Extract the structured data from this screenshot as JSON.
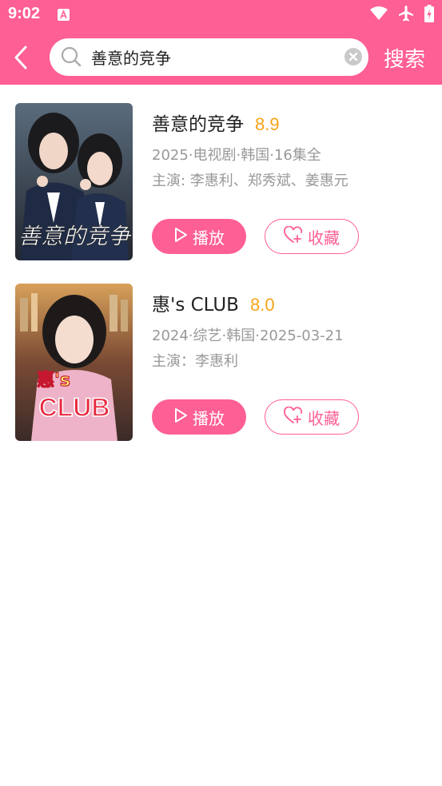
{
  "status_bar": {
    "time": "9:02"
  },
  "header": {
    "search_value": "善意的竞争",
    "search_button_label": "搜索"
  },
  "results": [
    {
      "title": "善意的竞争",
      "score": "8.9",
      "info": "2025·电视剧·韩国·16集全",
      "cast": "主演: 李惠利、郑秀斌、姜惠元",
      "poster_caption": "善意的竞争",
      "play_label": "播放",
      "fav_label": "收藏"
    },
    {
      "title": "惠's CLUB",
      "score": "8.0",
      "info": "2024·综艺·韩国·2025-03-21",
      "cast": "主演：李惠利",
      "poster_caption_top": "惠's",
      "poster_caption_bottom": "CLUB",
      "play_label": "播放",
      "fav_label": "收藏"
    }
  ],
  "colors": {
    "accent": "#fe5f94",
    "score": "#f7a319"
  }
}
